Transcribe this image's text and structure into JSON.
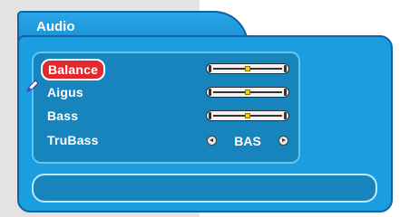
{
  "menu": {
    "title": "Audio",
    "items": [
      {
        "label": "Balance",
        "type": "slider",
        "level": 0.5,
        "selected": true
      },
      {
        "label": "Aigus",
        "type": "slider",
        "level": 0.5,
        "selected": false
      },
      {
        "label": "Bass",
        "type": "slider",
        "level": 0.5,
        "selected": false
      },
      {
        "label": "TruBass",
        "type": "selector",
        "value": "BAS",
        "selected": false
      }
    ]
  },
  "status": {
    "text": ""
  },
  "colors": {
    "panel": "#1b9ee0",
    "panel_border": "#1162a3",
    "inner_panel": "#1784be",
    "highlight": "#e4292e",
    "slider_thumb": "#f4d500",
    "background_gray": "#e3e3e3"
  },
  "icons": {
    "cursor": "pen-cursor-icon"
  }
}
